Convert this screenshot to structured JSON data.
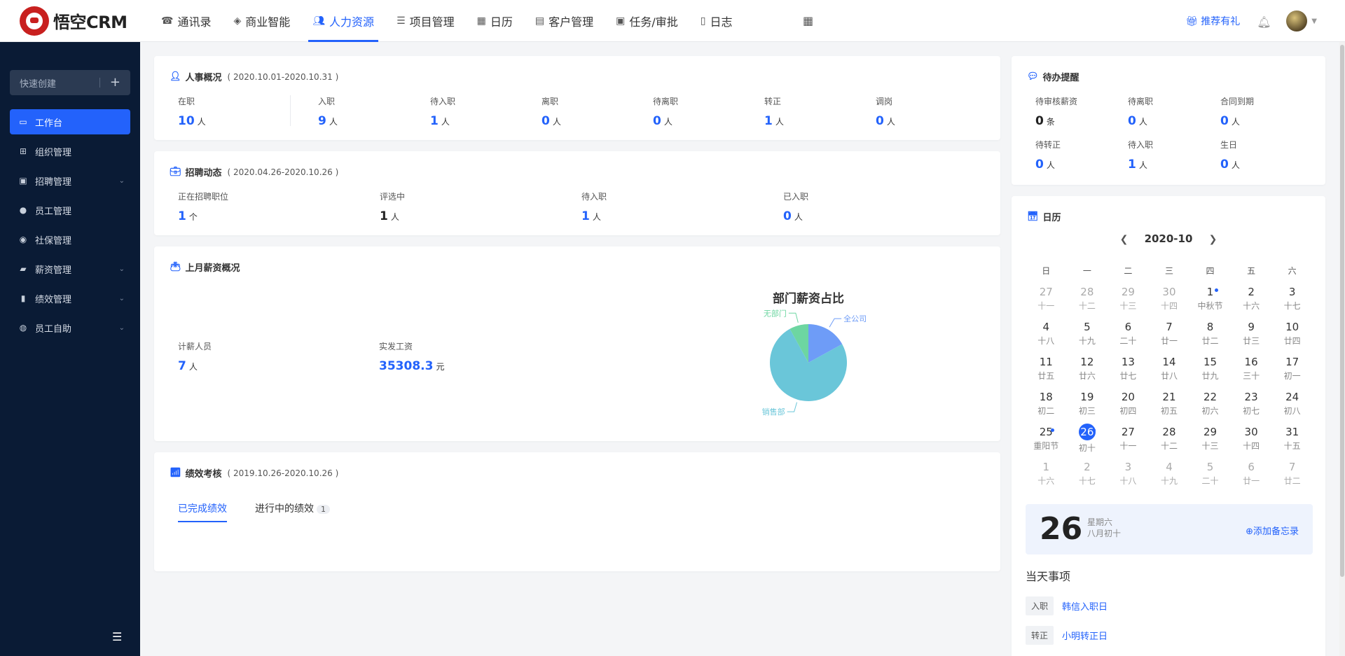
{
  "brand": {
    "name": "悟空CRM"
  },
  "nav": {
    "items": [
      {
        "label": "通讯录",
        "icon": "contacts-icon"
      },
      {
        "label": "商业智能",
        "icon": "bi-icon"
      },
      {
        "label": "人力资源",
        "icon": "hr-icon",
        "active": true
      },
      {
        "label": "项目管理",
        "icon": "project-icon"
      },
      {
        "label": "日历",
        "icon": "calendar-icon"
      },
      {
        "label": "客户管理",
        "icon": "customer-icon"
      },
      {
        "label": "任务/审批",
        "icon": "task-icon"
      },
      {
        "label": "日志",
        "icon": "log-icon"
      }
    ],
    "promo": "推荐有礼"
  },
  "sidebar": {
    "quick_create": "快速创建",
    "items": [
      {
        "label": "工作台",
        "icon": "monitor-icon",
        "active": true
      },
      {
        "label": "组织管理",
        "icon": "org-icon"
      },
      {
        "label": "招聘管理",
        "icon": "briefcase-icon",
        "expandable": true
      },
      {
        "label": "员工管理",
        "icon": "user-icon"
      },
      {
        "label": "社保管理",
        "icon": "shield-icon"
      },
      {
        "label": "薪资管理",
        "icon": "wallet-icon",
        "expandable": true
      },
      {
        "label": "绩效管理",
        "icon": "chart-icon",
        "expandable": true
      },
      {
        "label": "员工自助",
        "icon": "self-service-icon",
        "expandable": true
      }
    ]
  },
  "personnel": {
    "title": "人事概况",
    "range": "( 2020.10.01-2020.10.31 )",
    "stats": [
      {
        "label": "在职",
        "value": "10",
        "unit": "人"
      },
      {
        "label": "入职",
        "value": "9",
        "unit": "人"
      },
      {
        "label": "待入职",
        "value": "1",
        "unit": "人"
      },
      {
        "label": "离职",
        "value": "0",
        "unit": "人"
      },
      {
        "label": "待离职",
        "value": "0",
        "unit": "人"
      },
      {
        "label": "转正",
        "value": "1",
        "unit": "人"
      },
      {
        "label": "调岗",
        "value": "0",
        "unit": "人"
      }
    ]
  },
  "recruit": {
    "title": "招聘动态",
    "range": "( 2020.04.26-2020.10.26 )",
    "stats": [
      {
        "label": "正在招聘职位",
        "value": "1",
        "unit": "个"
      },
      {
        "label": "评选中",
        "value": "1",
        "unit": "人"
      },
      {
        "label": "待入职",
        "value": "1",
        "unit": "人"
      },
      {
        "label": "已入职",
        "value": "0",
        "unit": "人"
      }
    ]
  },
  "salary": {
    "title": "上月薪资概况",
    "stats": [
      {
        "label": "计薪人员",
        "value": "7",
        "unit": "人"
      },
      {
        "label": "实发工资",
        "value": "35308.3",
        "unit": "元"
      }
    ]
  },
  "chart_data": {
    "type": "pie",
    "title": "部门薪资占比",
    "slices": [
      {
        "name": "全公司",
        "value": 17,
        "color": "#6e9cf7"
      },
      {
        "name": "销售部",
        "value": 75,
        "color": "#6ac6d9"
      },
      {
        "name": "无部门",
        "value": 8,
        "color": "#6dd6a1"
      }
    ]
  },
  "performance": {
    "title": "绩效考核",
    "range": "( 2019.10.26-2020.10.26 )",
    "tabs": [
      {
        "label": "已完成绩效",
        "active": true
      },
      {
        "label": "进行中的绩效",
        "badge": "1"
      }
    ]
  },
  "todo": {
    "title": "待办提醒",
    "items": [
      {
        "label": "待审核薪资",
        "value": "0",
        "unit": "条",
        "dark": true
      },
      {
        "label": "待离职",
        "value": "0",
        "unit": "人"
      },
      {
        "label": "合同到期",
        "value": "0",
        "unit": "人"
      },
      {
        "label": "待转正",
        "value": "0",
        "unit": "人"
      },
      {
        "label": "待入职",
        "value": "1",
        "unit": "人"
      },
      {
        "label": "生日",
        "value": "0",
        "unit": "人"
      }
    ]
  },
  "calendar": {
    "title": "日历",
    "month": "2020-10",
    "weekdays": [
      "日",
      "一",
      "二",
      "三",
      "四",
      "五",
      "六"
    ],
    "weeks": [
      [
        [
          "27",
          "十一",
          1
        ],
        [
          "28",
          "十二",
          1
        ],
        [
          "29",
          "十三",
          1
        ],
        [
          "30",
          "十四",
          1
        ],
        [
          "1",
          "中秋节",
          0,
          1
        ],
        [
          "2",
          "十六",
          0
        ],
        [
          "3",
          "十七",
          0
        ]
      ],
      [
        [
          "4",
          "十八",
          0
        ],
        [
          "5",
          "十九",
          0
        ],
        [
          "6",
          "二十",
          0
        ],
        [
          "7",
          "廿一",
          0
        ],
        [
          "8",
          "廿二",
          0
        ],
        [
          "9",
          "廿三",
          0
        ],
        [
          "10",
          "廿四",
          0
        ]
      ],
      [
        [
          "11",
          "廿五",
          0
        ],
        [
          "12",
          "廿六",
          0
        ],
        [
          "13",
          "廿七",
          0
        ],
        [
          "14",
          "廿八",
          0
        ],
        [
          "15",
          "廿九",
          0
        ],
        [
          "16",
          "三十",
          0
        ],
        [
          "17",
          "初一",
          0
        ]
      ],
      [
        [
          "18",
          "初二",
          0
        ],
        [
          "19",
          "初三",
          0
        ],
        [
          "20",
          "初四",
          0
        ],
        [
          "21",
          "初五",
          0
        ],
        [
          "22",
          "初六",
          0
        ],
        [
          "23",
          "初七",
          0
        ],
        [
          "24",
          "初八",
          0
        ]
      ],
      [
        [
          "25",
          "重阳节",
          0,
          1
        ],
        [
          "26",
          "初十",
          0,
          1,
          1
        ],
        [
          "27",
          "十一",
          0
        ],
        [
          "28",
          "十二",
          0
        ],
        [
          "29",
          "十三",
          0
        ],
        [
          "30",
          "十四",
          0
        ],
        [
          "31",
          "十五",
          0
        ]
      ],
      [
        [
          "1",
          "十六",
          1
        ],
        [
          "2",
          "十七",
          1
        ],
        [
          "3",
          "十八",
          1
        ],
        [
          "4",
          "十九",
          1
        ],
        [
          "5",
          "二十",
          1
        ],
        [
          "6",
          "廿一",
          1
        ],
        [
          "7",
          "廿二",
          1
        ]
      ]
    ],
    "memo_day": "26",
    "memo_week": "星期六",
    "memo_lunar": "八月初十",
    "memo_add": "添加备忘录",
    "today_title": "当天事项",
    "events": [
      {
        "tag": "入职",
        "name": "韩信入职日"
      },
      {
        "tag": "转正",
        "name": "小明转正日"
      }
    ]
  }
}
